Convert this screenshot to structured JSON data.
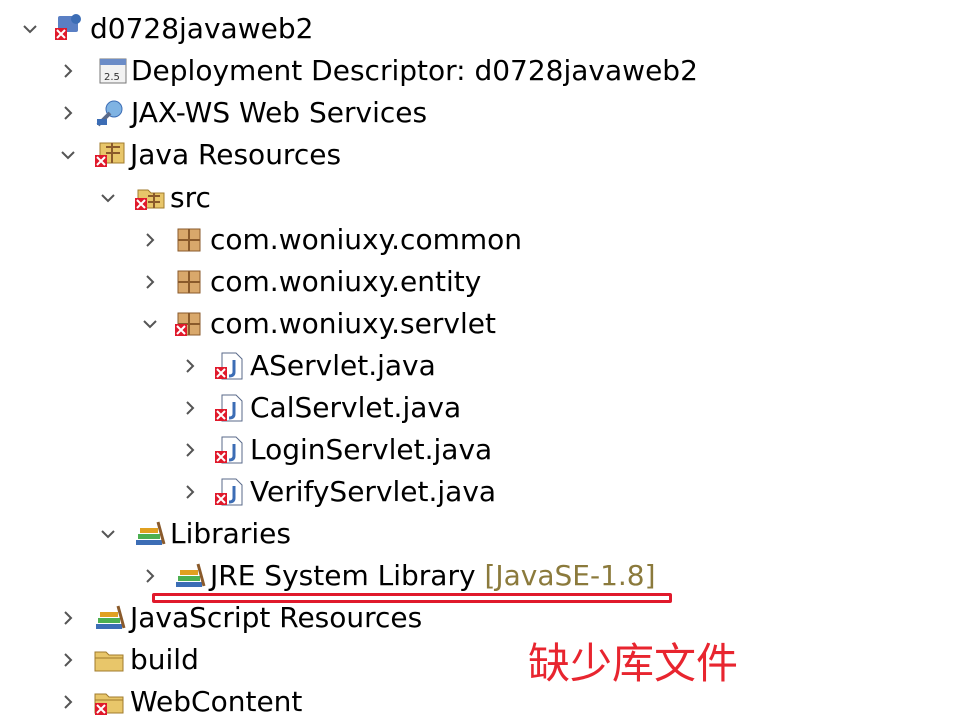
{
  "tree": {
    "project": "d0728javaweb2",
    "deployment_descriptor": "Deployment Descriptor: d0728javaweb2",
    "jaxws": "JAX-WS Web Services",
    "java_resources": "Java Resources",
    "src": "src",
    "pkg_common": "com.woniuxy.common",
    "pkg_entity": "com.woniuxy.entity",
    "pkg_servlet": "com.woniuxy.servlet",
    "files": [
      "AServlet.java",
      "CalServlet.java",
      "LoginServlet.java",
      "VerifyServlet.java"
    ],
    "libraries": "Libraries",
    "jre_label": "JRE System Library",
    "jre_decoration": "[JavaSE-1.8]",
    "javascript_resources": "JavaScript Resources",
    "build": "build",
    "webcontent": "WebContent"
  },
  "annotation": {
    "text": "缺少库文件",
    "color": "#e8252f"
  },
  "colors": {
    "error_red": "#e0192b",
    "decoration": "#8b7a3c",
    "package_brown": "#8a5a2b",
    "folder_yellow": "#e8c66a"
  }
}
